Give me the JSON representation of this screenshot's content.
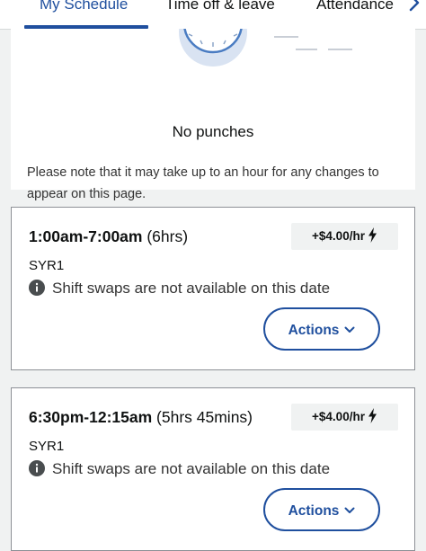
{
  "tabs": [
    {
      "label": "My Schedule",
      "active": true
    },
    {
      "label": "Time off & leave",
      "active": false
    },
    {
      "label": "Attendance",
      "active": false
    }
  ],
  "punches": {
    "empty_title": "No punches",
    "note": "Please note that it may take up to an hour for any changes to appear on this page."
  },
  "shifts": [
    {
      "time_range": "1:00am-7:00am",
      "duration": "(6hrs)",
      "premium": "+$4.00/hr",
      "site": "SYR1",
      "swap_note": "Shift swaps are not available on this date",
      "actions_label": "Actions"
    },
    {
      "time_range": "6:30pm-12:15am",
      "duration": "(5hrs 45mins)",
      "premium": "+$4.00/hr",
      "site": "SYR1",
      "swap_note": "Shift swaps are not available on this date",
      "actions_label": "Actions"
    }
  ],
  "colors": {
    "accent": "#1f4f9e",
    "page_background": "#f0f2f2",
    "card_border": "#8d9096"
  },
  "icons": {
    "premium": "lightning-bolt-icon",
    "info": "info-circle-icon",
    "actions": "chevron-down-icon",
    "tabs_scroll": "chevron-right-icon"
  }
}
